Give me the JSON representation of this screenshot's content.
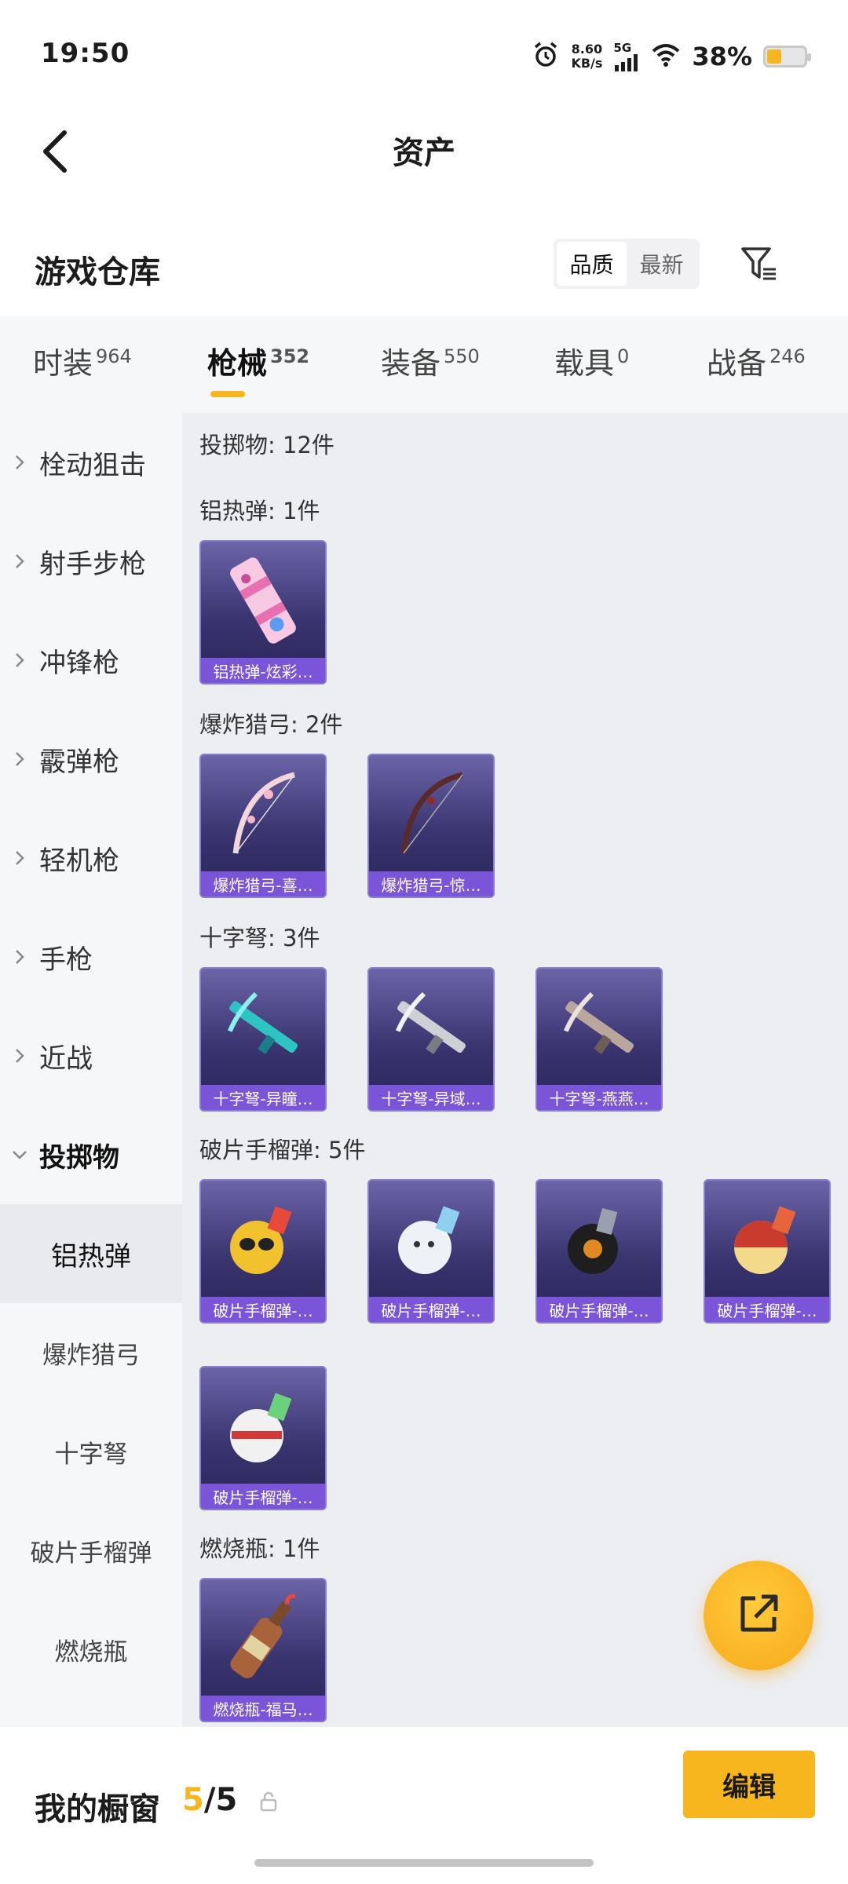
{
  "status_bar": {
    "time": "19:50",
    "net_speed_value": "8.60",
    "net_speed_unit": "KB/s",
    "network": "5G",
    "battery_pct": "38%",
    "battery_level": 0.38,
    "accent": "#f7b51e"
  },
  "header": {
    "title": "资产",
    "back_icon": "chevron-left-icon"
  },
  "section": {
    "title": "游戏仓库",
    "sort_options": [
      "品质",
      "最新"
    ],
    "sort_active": "品质",
    "filter_icon": "filter-icon"
  },
  "tabs": [
    {
      "label": "时装",
      "count": "964"
    },
    {
      "label": "枪械",
      "count": "352",
      "active": true
    },
    {
      "label": "装备",
      "count": "550"
    },
    {
      "label": "载具",
      "count": "0"
    },
    {
      "label": "战备",
      "count": "246"
    }
  ],
  "sidebar": {
    "categories": [
      "栓动狙击",
      "射手步枪",
      "冲锋枪",
      "霰弹枪",
      "轻机枪",
      "手枪",
      "近战",
      "投掷物"
    ],
    "open_category": "投掷物",
    "subcategories": [
      "铝热弹",
      "爆炸猎弓",
      "十字弩",
      "破片手榴弹",
      "燃烧瓶"
    ],
    "active_sub": "铝热弹"
  },
  "content": {
    "summary": "投掷物: 12件",
    "groups": [
      {
        "label": "铝热弹: 1件",
        "items": [
          "铝热弹-炫彩…"
        ]
      },
      {
        "label": "爆炸猎弓: 2件",
        "items": [
          "爆炸猎弓-喜…",
          "爆炸猎弓-惊…"
        ]
      },
      {
        "label": "十字弩: 3件",
        "items": [
          "十字弩-异瞳…",
          "十字弩-异域…",
          "十字弩-燕燕…"
        ]
      },
      {
        "label": "破片手榴弹: 5件",
        "items": [
          "破片手榴弹-…",
          "破片手榴弹-…",
          "破片手榴弹-…",
          "破片手榴弹-…",
          "破片手榴弹-…"
        ]
      },
      {
        "label": "燃烧瓶: 1件",
        "items": [
          "燃烧瓶-福马…"
        ]
      }
    ]
  },
  "fab": {
    "icon": "share-external-icon"
  },
  "bottom": {
    "showcase_label": "我的橱窗",
    "current": "5",
    "separator": "/",
    "total": "5",
    "lock_icon": "lock-icon",
    "edit_label": "编辑"
  }
}
